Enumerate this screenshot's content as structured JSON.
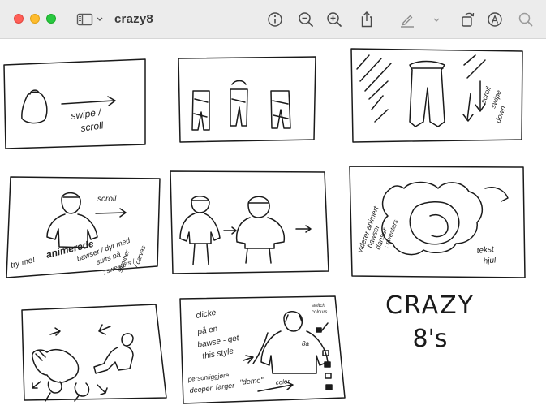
{
  "window": {
    "title": "crazy8",
    "colors": {
      "close": "#ff5f57",
      "minimize": "#febc2e",
      "maximize": "#28c840",
      "toolbar_bg": "#ececec"
    }
  },
  "toolbar": {
    "icons": [
      "sidebar-icon",
      "chevron-down-icon",
      "info-icon",
      "zoom-out-icon",
      "zoom-in-icon",
      "share-icon",
      "highlight-pen-icon",
      "chevron-down-icon",
      "rotate-icon",
      "markup-icon",
      "search-icon"
    ]
  },
  "sketches": [
    {
      "id": 1,
      "notes": [
        "swipe /",
        "scroll"
      ]
    },
    {
      "id": 2,
      "notes": []
    },
    {
      "id": 3,
      "notes": [
        "scroll",
        "swipe",
        "down"
      ]
    },
    {
      "id": 4,
      "notes": [
        "scroll",
        "try me!",
        "animerede",
        "bawser / dyr med",
        "suits på",
        "slumber",
        "; sweaters /",
        "/ carvas"
      ]
    },
    {
      "id": 5,
      "notes": []
    },
    {
      "id": 6,
      "notes": [
        "viderer animert",
        "bawser",
        "danser",
        "; sweaters",
        "tekst",
        "hjul"
      ]
    },
    {
      "id": 7,
      "notes": []
    },
    {
      "id": 8,
      "notes": [
        "clicke",
        "på en",
        "bawse - get",
        "this style",
        "8a",
        "deeper",
        "farger",
        "\"demo\"",
        "color",
        "personliggjøre",
        "switch",
        "colours"
      ]
    }
  ],
  "heading": {
    "line1": "CRAZY",
    "line2": "8's"
  }
}
